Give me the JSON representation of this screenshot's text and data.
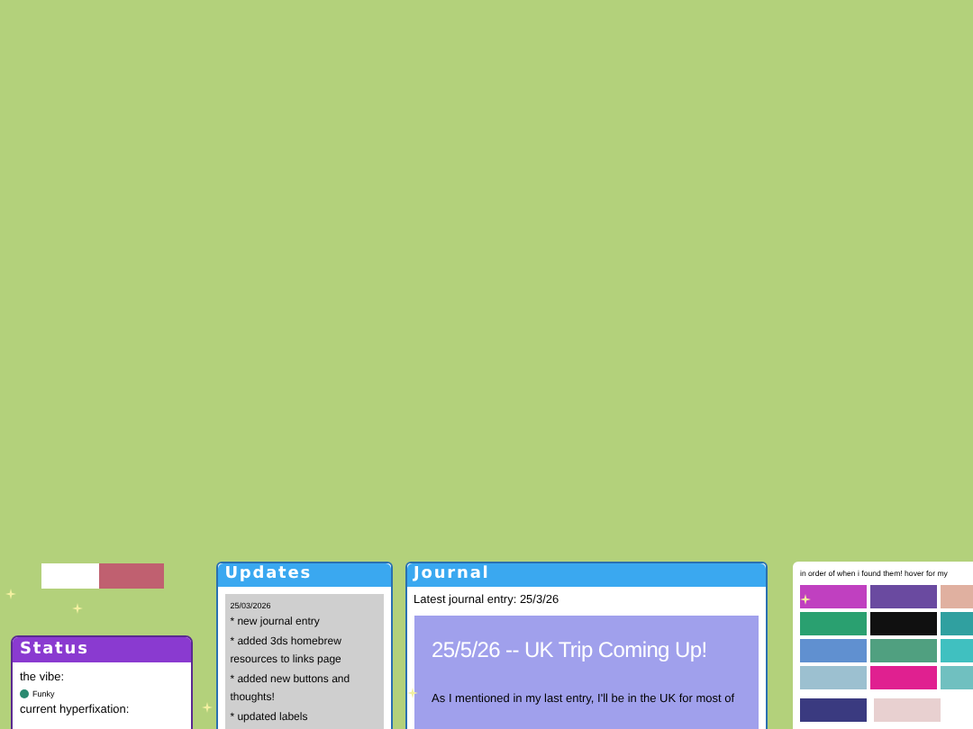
{
  "status": {
    "title": "Status",
    "vibe_label": "the vibe:",
    "vibe": "Funky",
    "hyperfixation_label": "current hyperfixation:"
  },
  "updates": {
    "title": "Updates",
    "date": "25/03/2026",
    "items": [
      "* new journal entry",
      "* added 3ds homebrew resources to links page",
      "* added new buttons and thoughts!",
      "* updated labels"
    ]
  },
  "journal": {
    "title": "Journal",
    "latest": "Latest journal entry: 25/3/26",
    "entry_title": "25/5/26 -- UK Trip Coming Up!",
    "entry_text": "As I mentioned in my last entry, I'll be in the UK for most of"
  },
  "buttons": {
    "caption": "in order of when i found them! hover for my"
  }
}
